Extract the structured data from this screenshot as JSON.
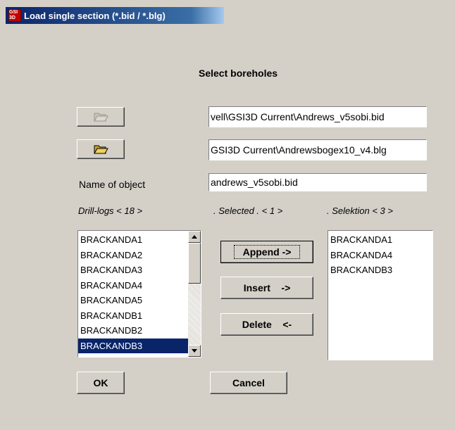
{
  "window": {
    "title": "Load single section (*.bid / *.blg)",
    "app_icon_text": "GSI 3D"
  },
  "heading": "Select boreholes",
  "files": {
    "bid_path": "vell\\GSI3D Current\\Andrews_v5sobi.bid",
    "blg_path": "GSI3D Current\\Andrewsbogex10_v4.blg"
  },
  "object": {
    "label": "Name of object",
    "value": "andrews_v5sobi.bid"
  },
  "lists": {
    "drill_logs_label": "Drill-logs < 18 >",
    "selected_label": ". Selected . < 1 >",
    "selection_label": ". Selektion < 3 >",
    "drill_logs": [
      "BRACKANDA1",
      "BRACKANDA2",
      "BRACKANDA3",
      "BRACKANDA4",
      "BRACKANDA5",
      "BRACKANDB1",
      "BRACKANDB2",
      "BRACKANDB3"
    ],
    "drill_logs_selected": "BRACKANDB3",
    "selection": [
      "BRACKANDA1",
      "BRACKANDA4",
      "BRACKANDB3"
    ]
  },
  "buttons": {
    "append": "Append ->",
    "insert": "Insert    ->",
    "delete": "Delete    <-",
    "ok": "OK",
    "cancel": "Cancel"
  },
  "icons": {
    "folder_bid": "folder-open-icon",
    "folder_blg": "folder-open-icon"
  },
  "colors": {
    "selection_bg": "#0a246a",
    "title_bg": "#0a246a",
    "dialog_bg": "#d4d0c8"
  }
}
